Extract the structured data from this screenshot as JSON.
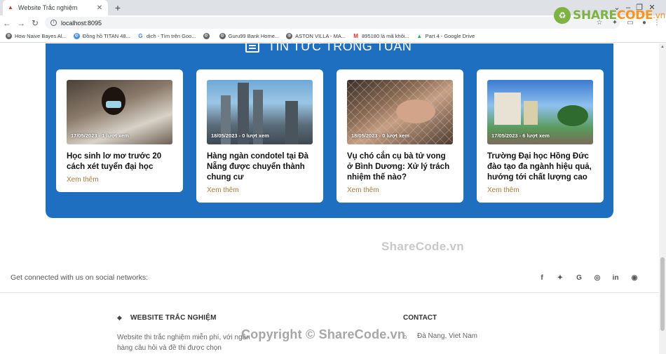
{
  "browser": {
    "tab_title": "Website Trắc nghiệm",
    "url": "localhost:8095",
    "bookmarks": [
      {
        "label": "How Naive Bayes Al...",
        "icon": "globe-icon",
        "color": "#5f6368"
      },
      {
        "label": "Đồng hồ TITAN 48...",
        "icon": "globe-icon",
        "color": "#4a90d9"
      },
      {
        "label": "dịch - Tìm trên Goo...",
        "icon": "google-icon",
        "color": "#4285f4"
      },
      {
        "label": "",
        "icon": "globe-icon",
        "color": "#5f6368"
      },
      {
        "label": "Guru99 Bank Home...",
        "icon": "globe-icon",
        "color": "#5f6368"
      },
      {
        "label": "ASTON VILLA - MA...",
        "icon": "globe-icon",
        "color": "#5f6368"
      },
      {
        "label": "895180 là mã khôi...",
        "icon": "gmail-icon",
        "color": "#d93025"
      },
      {
        "label": "Part 4 - Google Drive",
        "icon": "drive-icon",
        "color": "#34a853"
      }
    ]
  },
  "logo": {
    "share": "SHARE",
    "code": "CODE",
    "vn": ".vn"
  },
  "news": {
    "heading": "TIN TỨC TRONG TUẦN",
    "cards": [
      {
        "meta": "17/05/2023 - 1 lượt xem",
        "title": "Học sinh lơ mơ trước 20 cách xét tuyển đại học",
        "more": "Xem thêm"
      },
      {
        "meta": "18/05/2023 - 0 lượt xem",
        "title": "Hàng ngàn condotel tại Đà Nẵng được chuyển thành chung cư",
        "more": "Xem thêm"
      },
      {
        "meta": "18/05/2023 - 0 lượt xem",
        "title": "Vụ chó cắn cụ bà tử vong ở Bình Dương: Xử lý trách nhiệm thế nào?",
        "more": "Xem thêm"
      },
      {
        "meta": "17/05/2023 - 6 lượt xem",
        "title": "Trường Đại học Hồng Đức đào tạo đa ngành hiệu quả, hướng tới chất lượng cao",
        "more": "Xem thêm"
      }
    ]
  },
  "watermark_center": "ShareCode.vn",
  "social": {
    "text": "Get connected with us on social networks:",
    "icons": [
      "facebook-icon",
      "twitter-icon",
      "google-icon",
      "instagram-icon",
      "linkedin-icon",
      "github-icon"
    ]
  },
  "footer": {
    "brand": "WEBSITE TRẮC NGHIỆM",
    "description": "Website thi trắc nghiệm miễn phí, với ngân hàng câu hỏi và đề thi được chọn",
    "contact_title": "CONTACT",
    "contact_address": "Đà Nang, Viet Nam",
    "copyright_watermark": "Copyright © ShareCode.vn"
  },
  "colors": {
    "section_bg": "#1e6fbf",
    "link": "#a97a3d",
    "logo_green": "#7cb342",
    "logo_orange": "#f7931e"
  }
}
